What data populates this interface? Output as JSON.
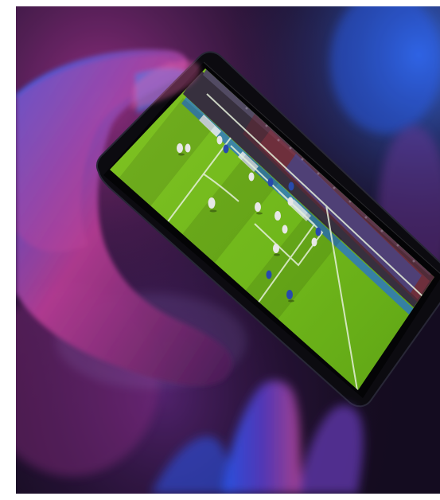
{
  "image": {
    "subject": "hand-holding-smartphone-showing-football-match",
    "colors": {
      "background_dark": "#1a1024",
      "neon_magenta": "#c03a9a",
      "neon_blue": "#2f5cff",
      "pitch_green": "#7cc71f",
      "phone_body": "#0d0c12",
      "crowd": "#3b3442"
    }
  }
}
